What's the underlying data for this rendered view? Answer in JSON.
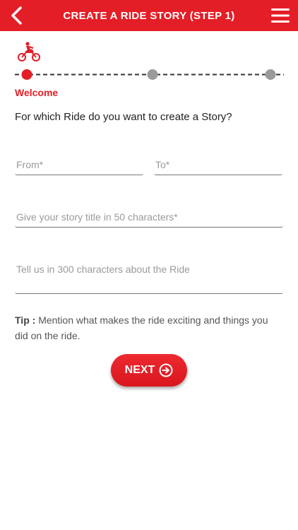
{
  "header": {
    "title": "CREATE A RIDE STORY (STEP 1)",
    "back_icon": "chevron-left-icon",
    "menu_icon": "hamburger-menu-icon",
    "background_color": "#e41e26"
  },
  "stepper": {
    "icon": "motorcycle-rider-icon",
    "steps_total": 3,
    "current_step": 1,
    "active_color": "#e41e26",
    "inactive_color": "#9a9a9a",
    "current_label": "Welcome"
  },
  "form": {
    "question": "For which Ride do you want to create a Story?",
    "from_placeholder": "From*",
    "to_placeholder": "To*",
    "title_placeholder": "Give your story title in 50 characters*",
    "description_placeholder": "Tell us in 300 characters about the Ride"
  },
  "tip": {
    "label": "Tip :",
    "text": "Mention what makes the ride exciting and things you did on the ride."
  },
  "next_button": {
    "label": "NEXT",
    "icon": "arrow-right-circle-icon"
  }
}
